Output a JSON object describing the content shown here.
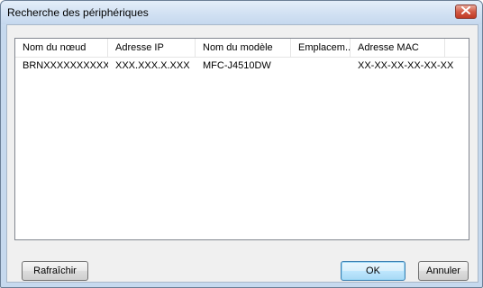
{
  "window": {
    "title": "Recherche des périphériques",
    "close_icon": "close-icon"
  },
  "list": {
    "columns": [
      "Nom du nœud",
      "Adresse IP",
      "Nom du modèle",
      "Emplacem...",
      "Adresse MAC"
    ],
    "rows": [
      [
        "BRNXXXXXXXXXXXX",
        "XXX.XXX.X.XXX",
        "MFC-J4510DW",
        "",
        "XX-XX-XX-XX-XX-XX"
      ]
    ]
  },
  "buttons": {
    "refresh": "Rafraîchir",
    "ok": "OK",
    "cancel": "Annuler"
  },
  "colors": {
    "title_bg": "#d3e2f3",
    "close_button": "#c03a24",
    "client_bg": "#f0f0f0"
  }
}
